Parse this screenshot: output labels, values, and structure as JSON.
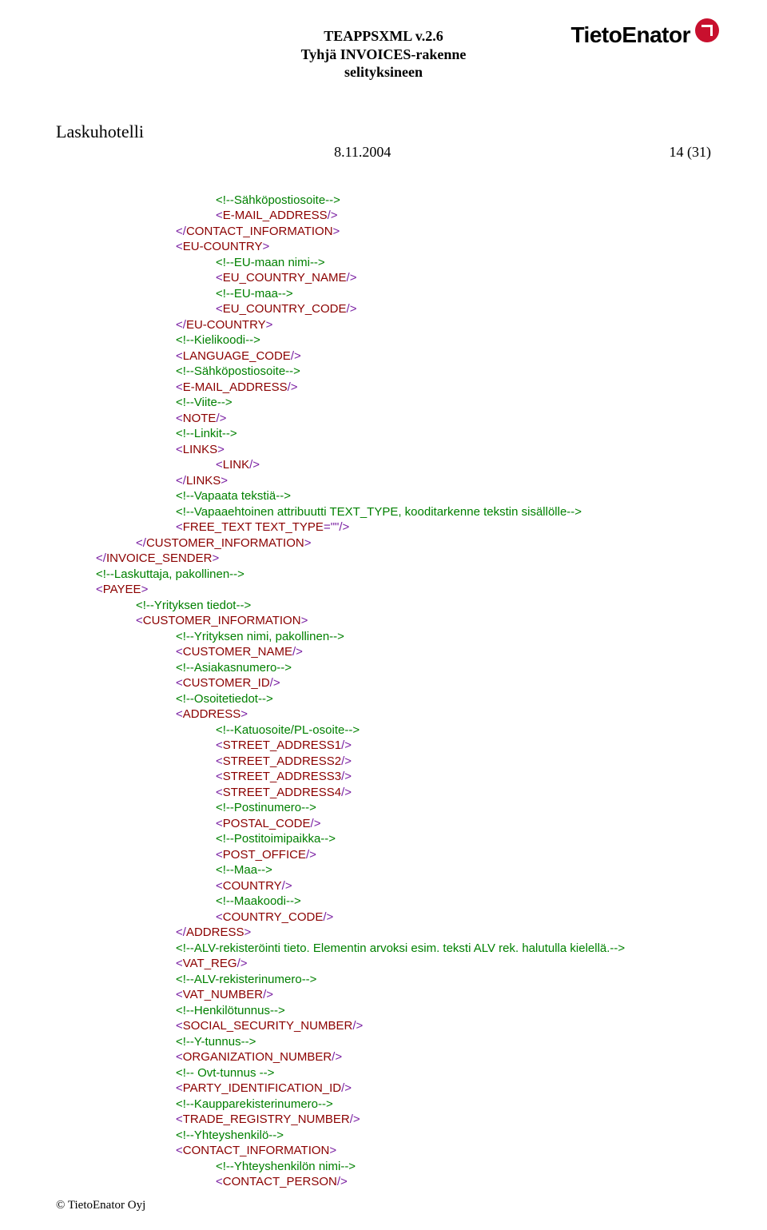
{
  "header": {
    "line1": "TEAPPSXML v.2.6",
    "line2": "Tyhjä INVOICES-rakenne",
    "line3": "selityksineen"
  },
  "logo": {
    "text": "TietoEnator"
  },
  "sub_title": "Laskuhotelli",
  "meta": {
    "date": "8.11.2004",
    "page": "14 (31)"
  },
  "lines": [
    {
      "ind": 2,
      "pieces": [
        {
          "c": "green",
          "t": "<!--Sähköpostiosoite-->"
        }
      ]
    },
    {
      "ind": 2,
      "pieces": [
        {
          "c": "purple",
          "t": "<"
        },
        {
          "c": "darkred",
          "t": "E-MAIL_ADDRESS"
        },
        {
          "c": "purple",
          "t": "/>"
        }
      ]
    },
    {
      "ind": 1,
      "pieces": [
        {
          "c": "purple",
          "t": "</"
        },
        {
          "c": "darkred",
          "t": "CONTACT_INFORMATION"
        },
        {
          "c": "purple",
          "t": ">"
        }
      ]
    },
    {
      "ind": 1,
      "pieces": [
        {
          "c": "purple",
          "t": "<"
        },
        {
          "c": "darkred",
          "t": "EU-COUNTRY"
        },
        {
          "c": "purple",
          "t": ">"
        }
      ]
    },
    {
      "ind": 2,
      "pieces": [
        {
          "c": "green",
          "t": "<!--EU-maan nimi-->"
        }
      ]
    },
    {
      "ind": 2,
      "pieces": [
        {
          "c": "purple",
          "t": "<"
        },
        {
          "c": "darkred",
          "t": "EU_COUNTRY_NAME"
        },
        {
          "c": "purple",
          "t": "/>"
        }
      ]
    },
    {
      "ind": 2,
      "pieces": [
        {
          "c": "green",
          "t": "<!--EU-maa-->"
        }
      ]
    },
    {
      "ind": 2,
      "pieces": [
        {
          "c": "purple",
          "t": "<"
        },
        {
          "c": "darkred",
          "t": "EU_COUNTRY_CODE"
        },
        {
          "c": "purple",
          "t": "/>"
        }
      ]
    },
    {
      "ind": 1,
      "pieces": [
        {
          "c": "purple",
          "t": "</"
        },
        {
          "c": "darkred",
          "t": "EU-COUNTRY"
        },
        {
          "c": "purple",
          "t": ">"
        }
      ]
    },
    {
      "ind": 1,
      "pieces": [
        {
          "c": "green",
          "t": "<!--Kielikoodi-->"
        }
      ]
    },
    {
      "ind": 1,
      "pieces": [
        {
          "c": "purple",
          "t": "<"
        },
        {
          "c": "darkred",
          "t": "LANGUAGE_CODE"
        },
        {
          "c": "purple",
          "t": "/>"
        }
      ]
    },
    {
      "ind": 1,
      "pieces": [
        {
          "c": "green",
          "t": "<!--Sähköpostiosoite-->"
        }
      ]
    },
    {
      "ind": 1,
      "pieces": [
        {
          "c": "purple",
          "t": "<"
        },
        {
          "c": "darkred",
          "t": "E-MAIL_ADDRESS"
        },
        {
          "c": "purple",
          "t": "/>"
        }
      ]
    },
    {
      "ind": 1,
      "pieces": [
        {
          "c": "green",
          "t": "<!--Viite-->"
        }
      ]
    },
    {
      "ind": 1,
      "pieces": [
        {
          "c": "purple",
          "t": "<"
        },
        {
          "c": "darkred",
          "t": "NOTE"
        },
        {
          "c": "purple",
          "t": "/>"
        }
      ]
    },
    {
      "ind": 1,
      "pieces": [
        {
          "c": "green",
          "t": "<!--Linkit-->"
        }
      ]
    },
    {
      "ind": 1,
      "pieces": [
        {
          "c": "purple",
          "t": "<"
        },
        {
          "c": "darkred",
          "t": "LINKS"
        },
        {
          "c": "purple",
          "t": ">"
        }
      ]
    },
    {
      "ind": 2,
      "pieces": [
        {
          "c": "purple",
          "t": "<"
        },
        {
          "c": "darkred",
          "t": "LINK"
        },
        {
          "c": "purple",
          "t": "/>"
        }
      ]
    },
    {
      "ind": 1,
      "pieces": [
        {
          "c": "purple",
          "t": "</"
        },
        {
          "c": "darkred",
          "t": "LINKS"
        },
        {
          "c": "purple",
          "t": ">"
        }
      ]
    },
    {
      "ind": 1,
      "pieces": [
        {
          "c": "green",
          "t": "<!--Vapaata tekstiä-->"
        }
      ]
    },
    {
      "ind": 1,
      "pieces": [
        {
          "c": "green",
          "t": "<!--Vapaaehtoinen attribuutti TEXT_TYPE, kooditarkenne tekstin sisällölle-->"
        }
      ]
    },
    {
      "ind": 1,
      "pieces": [
        {
          "c": "purple",
          "t": "<"
        },
        {
          "c": "darkred",
          "t": "FREE_TEXT TEXT_TYPE"
        },
        {
          "c": "purple",
          "t": "=\""
        },
        {
          "c": "purple",
          "t": "\"/>"
        }
      ]
    },
    {
      "ind": 0,
      "pieces": [
        {
          "c": "purple",
          "t": "</"
        },
        {
          "c": "darkred",
          "t": "CUSTOMER_INFORMATION"
        },
        {
          "c": "purple",
          "t": ">"
        }
      ]
    },
    {
      "ind": -1,
      "pieces": [
        {
          "c": "purple",
          "t": "</"
        },
        {
          "c": "darkred",
          "t": "INVOICE_SENDER"
        },
        {
          "c": "purple",
          "t": ">"
        }
      ]
    },
    {
      "ind": -1,
      "pieces": [
        {
          "c": "green",
          "t": "<!--Laskuttaja, pakollinen-->"
        }
      ]
    },
    {
      "ind": -1,
      "pieces": [
        {
          "c": "purple",
          "t": "<"
        },
        {
          "c": "darkred",
          "t": "PAYEE"
        },
        {
          "c": "purple",
          "t": ">"
        }
      ]
    },
    {
      "ind": 0,
      "pieces": [
        {
          "c": "green",
          "t": "<!--Yrityksen tiedot-->"
        }
      ]
    },
    {
      "ind": 0,
      "pieces": [
        {
          "c": "purple",
          "t": "<"
        },
        {
          "c": "darkred",
          "t": "CUSTOMER_INFORMATION"
        },
        {
          "c": "purple",
          "t": ">"
        }
      ]
    },
    {
      "ind": 1,
      "pieces": [
        {
          "c": "green",
          "t": "<!--Yrityksen nimi, pakollinen-->"
        }
      ]
    },
    {
      "ind": 1,
      "pieces": [
        {
          "c": "purple",
          "t": "<"
        },
        {
          "c": "darkred",
          "t": "CUSTOMER_NAME"
        },
        {
          "c": "purple",
          "t": "/>"
        }
      ]
    },
    {
      "ind": 1,
      "pieces": [
        {
          "c": "green",
          "t": "<!--Asiakasnumero-->"
        }
      ]
    },
    {
      "ind": 1,
      "pieces": [
        {
          "c": "purple",
          "t": "<"
        },
        {
          "c": "darkred",
          "t": "CUSTOMER_ID"
        },
        {
          "c": "purple",
          "t": "/>"
        }
      ]
    },
    {
      "ind": 1,
      "pieces": [
        {
          "c": "green",
          "t": "<!--Osoitetiedot-->"
        }
      ]
    },
    {
      "ind": 1,
      "pieces": [
        {
          "c": "purple",
          "t": "<"
        },
        {
          "c": "darkred",
          "t": "ADDRESS"
        },
        {
          "c": "purple",
          "t": ">"
        }
      ]
    },
    {
      "ind": 2,
      "pieces": [
        {
          "c": "green",
          "t": "<!--Katuosoite/PL-osoite-->"
        }
      ]
    },
    {
      "ind": 2,
      "pieces": [
        {
          "c": "purple",
          "t": "<"
        },
        {
          "c": "darkred",
          "t": "STREET_ADDRESS1"
        },
        {
          "c": "purple",
          "t": "/>"
        }
      ]
    },
    {
      "ind": 2,
      "pieces": [
        {
          "c": "purple",
          "t": "<"
        },
        {
          "c": "darkred",
          "t": "STREET_ADDRESS2"
        },
        {
          "c": "purple",
          "t": "/>"
        }
      ]
    },
    {
      "ind": 2,
      "pieces": [
        {
          "c": "purple",
          "t": "<"
        },
        {
          "c": "darkred",
          "t": "STREET_ADDRESS3"
        },
        {
          "c": "purple",
          "t": "/>"
        }
      ]
    },
    {
      "ind": 2,
      "pieces": [
        {
          "c": "purple",
          "t": "<"
        },
        {
          "c": "darkred",
          "t": "STREET_ADDRESS4"
        },
        {
          "c": "purple",
          "t": "/>"
        }
      ]
    },
    {
      "ind": 2,
      "pieces": [
        {
          "c": "green",
          "t": "<!--Postinumero-->"
        }
      ]
    },
    {
      "ind": 2,
      "pieces": [
        {
          "c": "purple",
          "t": "<"
        },
        {
          "c": "darkred",
          "t": "POSTAL_CODE"
        },
        {
          "c": "purple",
          "t": "/>"
        }
      ]
    },
    {
      "ind": 2,
      "pieces": [
        {
          "c": "green",
          "t": "<!--Postitoimipaikka-->"
        }
      ]
    },
    {
      "ind": 2,
      "pieces": [
        {
          "c": "purple",
          "t": "<"
        },
        {
          "c": "darkred",
          "t": "POST_OFFICE"
        },
        {
          "c": "purple",
          "t": "/>"
        }
      ]
    },
    {
      "ind": 2,
      "pieces": [
        {
          "c": "green",
          "t": "<!--Maa-->"
        }
      ]
    },
    {
      "ind": 2,
      "pieces": [
        {
          "c": "purple",
          "t": "<"
        },
        {
          "c": "darkred",
          "t": "COUNTRY"
        },
        {
          "c": "purple",
          "t": "/>"
        }
      ]
    },
    {
      "ind": 2,
      "pieces": [
        {
          "c": "green",
          "t": "<!--Maakoodi-->"
        }
      ]
    },
    {
      "ind": 2,
      "pieces": [
        {
          "c": "purple",
          "t": "<"
        },
        {
          "c": "darkred",
          "t": "COUNTRY_CODE"
        },
        {
          "c": "purple",
          "t": "/>"
        }
      ]
    },
    {
      "ind": 1,
      "pieces": [
        {
          "c": "purple",
          "t": "</"
        },
        {
          "c": "darkred",
          "t": "ADDRESS"
        },
        {
          "c": "purple",
          "t": ">"
        }
      ]
    },
    {
      "ind": 1,
      "pieces": [
        {
          "c": "green",
          "t": "<!--ALV-rekisteröinti tieto. Elementin arvoksi esim. teksti ALV rek. halutulla kielellä.-->"
        }
      ]
    },
    {
      "ind": 1,
      "pieces": [
        {
          "c": "purple",
          "t": "<"
        },
        {
          "c": "darkred",
          "t": "VAT_REG"
        },
        {
          "c": "purple",
          "t": "/>"
        }
      ]
    },
    {
      "ind": 1,
      "pieces": [
        {
          "c": "green",
          "t": "<!--ALV-rekisterinumero-->"
        }
      ]
    },
    {
      "ind": 1,
      "pieces": [
        {
          "c": "purple",
          "t": "<"
        },
        {
          "c": "darkred",
          "t": "VAT_NUMBER"
        },
        {
          "c": "purple",
          "t": "/>"
        }
      ]
    },
    {
      "ind": 1,
      "pieces": [
        {
          "c": "green",
          "t": "<!--Henkilötunnus-->"
        }
      ]
    },
    {
      "ind": 1,
      "pieces": [
        {
          "c": "purple",
          "t": "<"
        },
        {
          "c": "darkred",
          "t": "SOCIAL_SECURITY_NUMBER"
        },
        {
          "c": "purple",
          "t": "/>"
        }
      ]
    },
    {
      "ind": 1,
      "pieces": [
        {
          "c": "green",
          "t": "<!--Y-tunnus-->"
        }
      ]
    },
    {
      "ind": 1,
      "pieces": [
        {
          "c": "purple",
          "t": "<"
        },
        {
          "c": "darkred",
          "t": "ORGANIZATION_NUMBER"
        },
        {
          "c": "purple",
          "t": "/>"
        }
      ]
    },
    {
      "ind": 1,
      "pieces": [
        {
          "c": "green",
          "t": "<!-- Ovt-tunnus -->"
        }
      ]
    },
    {
      "ind": 1,
      "pieces": [
        {
          "c": "purple",
          "t": "<"
        },
        {
          "c": "darkred",
          "t": "PARTY_IDENTIFICATION_ID"
        },
        {
          "c": "purple",
          "t": "/>"
        }
      ]
    },
    {
      "ind": 1,
      "pieces": [
        {
          "c": "green",
          "t": "<!--Kaupparekisterinumero-->"
        }
      ]
    },
    {
      "ind": 1,
      "pieces": [
        {
          "c": "purple",
          "t": "<"
        },
        {
          "c": "darkred",
          "t": "TRADE_REGISTRY_NUMBER"
        },
        {
          "c": "purple",
          "t": "/>"
        }
      ]
    },
    {
      "ind": 1,
      "pieces": [
        {
          "c": "green",
          "t": "<!--Yhteyshenkilö-->"
        }
      ]
    },
    {
      "ind": 1,
      "pieces": [
        {
          "c": "purple",
          "t": "<"
        },
        {
          "c": "darkred",
          "t": "CONTACT_INFORMATION"
        },
        {
          "c": "purple",
          "t": ">"
        }
      ]
    },
    {
      "ind": 2,
      "pieces": [
        {
          "c": "green",
          "t": "<!--Yhteyshenkilön nimi-->"
        }
      ]
    },
    {
      "ind": 2,
      "pieces": [
        {
          "c": "purple",
          "t": "<"
        },
        {
          "c": "darkred",
          "t": "CONTACT_PERSON"
        },
        {
          "c": "purple",
          "t": "/>"
        }
      ]
    }
  ],
  "footer": "© TietoEnator Oyj"
}
